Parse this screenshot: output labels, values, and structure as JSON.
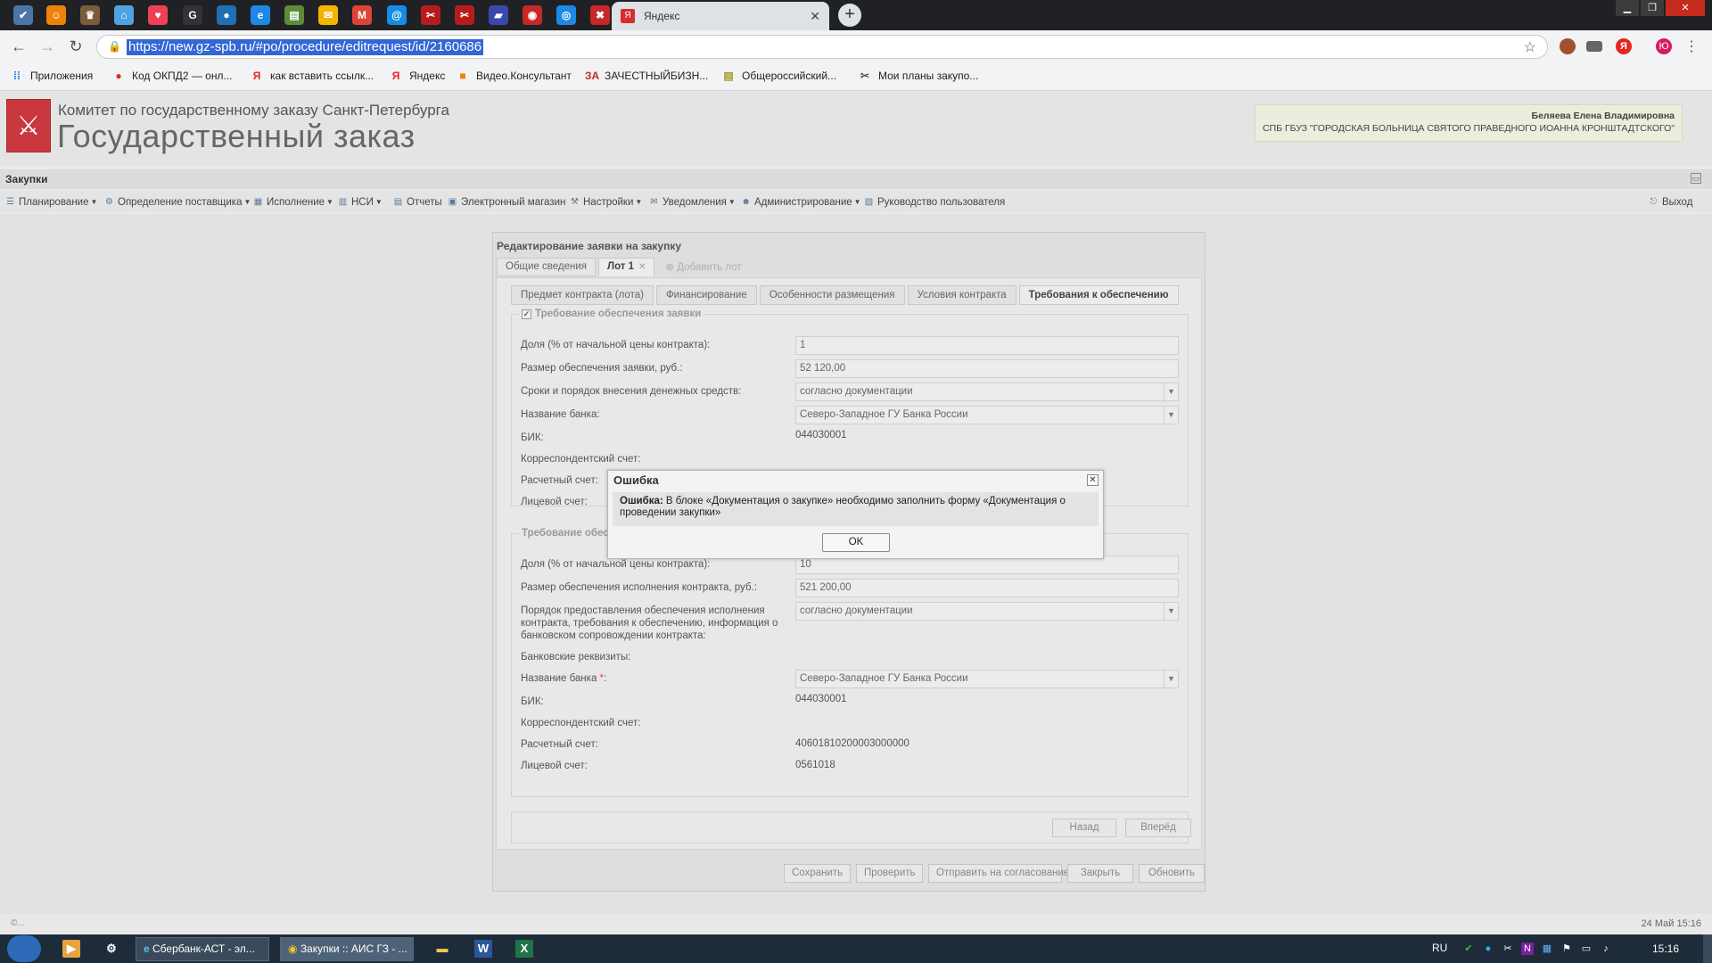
{
  "browser": {
    "tabs": [
      {
        "icon": "vk-icon",
        "glyph": "✔",
        "color": "#4a76a8"
      },
      {
        "icon": "odnoklassniki-icon",
        "glyph": "☺",
        "color": "#ee8208"
      },
      {
        "icon": "emblem-icon",
        "glyph": "♛",
        "color": "#7a5c3a"
      },
      {
        "icon": "home-icon",
        "glyph": "⌂",
        "color": "#4fa3e0"
      },
      {
        "icon": "pocket-icon",
        "glyph": "♥",
        "color": "#ef4056"
      },
      {
        "icon": "g-icon",
        "glyph": "G",
        "color": "#333333"
      },
      {
        "icon": "chat-icon",
        "glyph": "●",
        "color": "#1f6fb2"
      },
      {
        "icon": "edge-icon",
        "glyph": "e",
        "color": "#1e88e5"
      },
      {
        "icon": "doc-icon",
        "glyph": "▤",
        "color": "#5b8c3a"
      },
      {
        "icon": "mail-icon",
        "glyph": "✉",
        "color": "#f4b400"
      },
      {
        "icon": "gmail-icon",
        "glyph": "M",
        "color": "#db4437"
      },
      {
        "icon": "at-icon",
        "glyph": "@",
        "color": "#168de2"
      },
      {
        "icon": "tools-icon",
        "glyph": "✂",
        "color": "#b71c1c"
      },
      {
        "icon": "tools-icon",
        "glyph": "✂",
        "color": "#b71c1c"
      },
      {
        "icon": "flag-icon",
        "glyph": "▰",
        "color": "#3949ab"
      },
      {
        "icon": "stamp-icon",
        "glyph": "◉",
        "color": "#c62828"
      },
      {
        "icon": "eye-icon",
        "glyph": "◎",
        "color": "#1e88e5"
      },
      {
        "icon": "gz-icon",
        "glyph": "✖",
        "color": "#c62828"
      }
    ],
    "active_tab": {
      "title": "Яндекс",
      "favicon": "Я"
    },
    "address": {
      "url": "https://new.gz-spb.ru/#po/procedure/editrequest/id/2160686"
    },
    "bookmarks": [
      {
        "label": "Приложения",
        "glyph": "⁞⁞",
        "color": "#1a73e8"
      },
      {
        "label": "Код ОКПД2 — онл...",
        "glyph": "●",
        "color": "#d93025"
      },
      {
        "label": "как вставить ссылк...",
        "glyph": "Я",
        "color": "#e52620"
      },
      {
        "label": "Яндекс",
        "glyph": "Я",
        "color": "#e52620"
      },
      {
        "label": "Видео.Консультант",
        "glyph": "■",
        "color": "#f57c00"
      },
      {
        "label": "ЗАЧЕСТНЫЙБИЗН...",
        "glyph": "ЗА",
        "color": "#c62828"
      },
      {
        "label": "Общероссийский...",
        "glyph": "▤",
        "color": "#9e9d24"
      },
      {
        "label": "Мои планы закупо...",
        "glyph": "✂",
        "color": "#555555"
      }
    ]
  },
  "header": {
    "committee": "Комитет по государственному заказу Санкт-Петербурга",
    "system_name": "Государственный заказ",
    "user_name": "Беляева Елена Владимировна",
    "organization": "СПБ ГБУЗ \"ГОРОДСКАЯ БОЛЬНИЦА СВЯТОГО ПРАВЕДНОГО ИОАННА КРОНШТАДТСКОГО\""
  },
  "section_title": "Закупки",
  "menu": [
    {
      "label": "Планирование",
      "dropdown": true,
      "icon": "planning-icon",
      "glyph": "☰"
    },
    {
      "label": "Определение поставщика",
      "dropdown": true,
      "icon": "supplier-icon",
      "glyph": "⚙"
    },
    {
      "label": "Исполнение",
      "dropdown": true,
      "icon": "execution-icon",
      "glyph": "▦"
    },
    {
      "label": "НСИ",
      "dropdown": true,
      "icon": "reference-icon",
      "glyph": "▥"
    },
    {
      "label": "Отчеты",
      "dropdown": false,
      "icon": "report-icon",
      "glyph": "▤"
    },
    {
      "label": "Электронный магазин",
      "dropdown": false,
      "icon": "shop-icon",
      "glyph": "▣"
    },
    {
      "label": "Настройки",
      "dropdown": true,
      "icon": "settings-icon",
      "glyph": "⚒"
    },
    {
      "label": "Уведомления",
      "dropdown": true,
      "icon": "notifications-icon",
      "glyph": "✉"
    },
    {
      "label": "Администрирование",
      "dropdown": true,
      "icon": "admin-icon",
      "glyph": "☻"
    },
    {
      "label": "Руководство пользователя",
      "dropdown": false,
      "icon": "manual-icon",
      "glyph": "▧"
    }
  ],
  "exit_label": "Выход",
  "panel": {
    "title": "Редактирование заявки на закупку",
    "top_tabs": [
      "Общие сведения",
      "Лот 1"
    ],
    "add_lot": "Добавить лот",
    "sub_tabs": [
      "Предмет контракта (лота)",
      "Финансирование",
      "Особенности размещения",
      "Условия контракта",
      "Требования к обеспечению"
    ],
    "application_security": {
      "legend": "Требование обеспечения заявки",
      "share_label": "Доля (% от начальной цены контракта):",
      "share_value": "1",
      "amount_label": "Размер обеспечения заявки, руб.:",
      "amount_value": "52 120,00",
      "terms_label": "Сроки и порядок внесения денежных средств:",
      "terms_value": "согласно документации",
      "bank_label": "Название банка:",
      "bank_value": "Северо-Западное ГУ Банка России",
      "bik_label": "БИК:",
      "bik_value": "044030001",
      "corr_label": "Корреспондентский счет:",
      "settlement_label": "Расчетный счет:",
      "personal_label": "Лицевой счет:"
    },
    "contract_security": {
      "legend": "Требование обес",
      "share_label": "Доля (% от начальной цены контракта):",
      "share_value": "10",
      "amount_label": "Размер обеспечения исполнения контракта, руб.:",
      "amount_value": "521 200,00",
      "order_label": "Порядок предоставления обеспечения исполнения контракта, требования к обеспечению, информация о банковском сопровождении контракта:",
      "order_value": "согласно документации",
      "bank_details_label": "Банковские реквизиты:",
      "bank_label": "Название банка",
      "bank_value": "Северо-Западное ГУ Банка России",
      "bik_label": "БИК:",
      "bik_value": "044030001",
      "corr_label": "Корреспондентский счет:",
      "settlement_label": "Расчетный счет:",
      "settlement_value": "40601810200003000000",
      "personal_label": "Лицевой счет:",
      "personal_value": "0561018"
    },
    "nav": {
      "back": "Назад",
      "forward": "Вперёд"
    },
    "footer": {
      "save": "Сохранить",
      "check": "Проверить",
      "send": "Отправить на согласование",
      "close": "Закрыть",
      "refresh": "Обновить"
    }
  },
  "dialog": {
    "title": "Ошибка",
    "message_bold": "Ошибка:",
    "message": " В блоке «Документация о закупке» необходимо заполнить форму «Документация о проведении закупки»",
    "ok": "OK"
  },
  "statusbar": {
    "copyright": "©...",
    "datetime": "24 Май 15:16"
  },
  "taskbar": {
    "tasks": [
      {
        "label": "Сбербанк-АСТ - эл...",
        "active": false
      },
      {
        "label": "Закупки :: АИС ГЗ - ...",
        "active": true
      }
    ],
    "language": "RU",
    "clock": "15:16"
  }
}
